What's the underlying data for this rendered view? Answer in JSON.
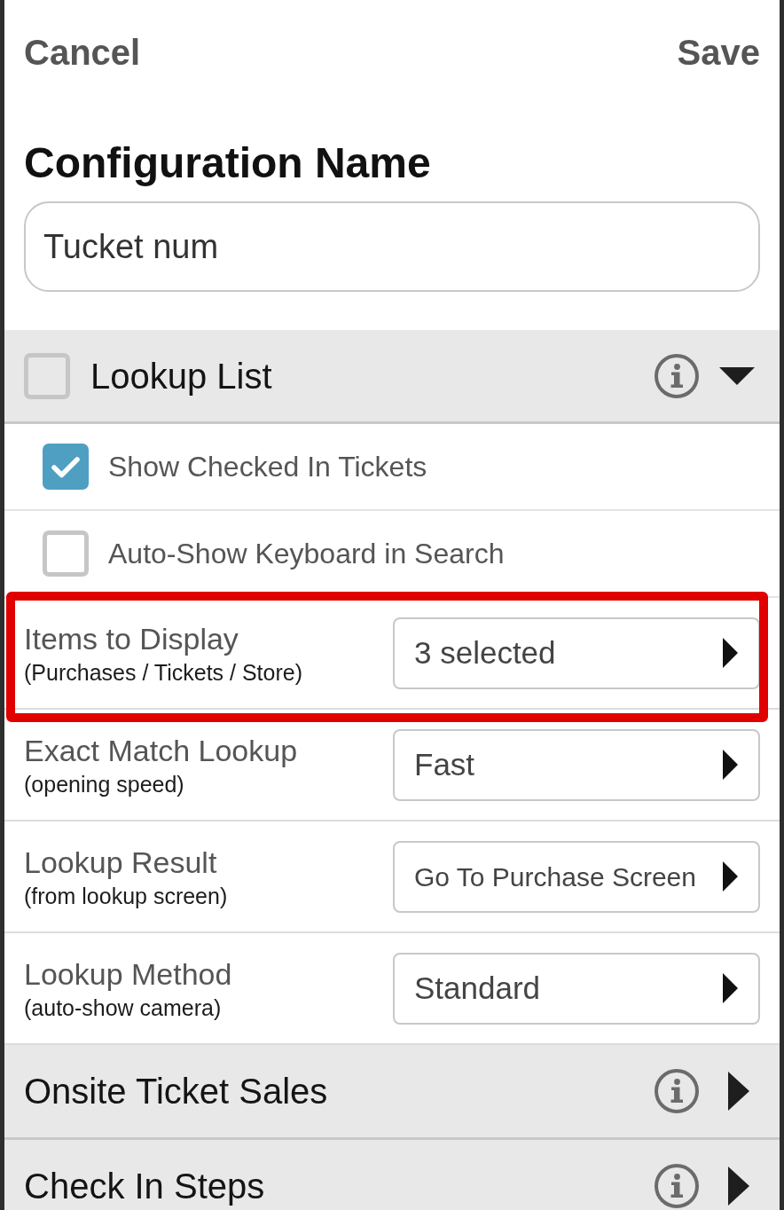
{
  "header": {
    "cancel": "Cancel",
    "save": "Save"
  },
  "configuration_name": {
    "label": "Configuration Name",
    "value": "Tucket num"
  },
  "sections": [
    {
      "title": "Lookup List",
      "kind": "checkable",
      "checked": false,
      "expanded": true,
      "options": [
        {
          "label": "Show Checked In Tickets",
          "checked": true
        },
        {
          "label": "Auto-Show Keyboard in Search",
          "checked": false
        }
      ],
      "settings": [
        {
          "label": "Items to Display",
          "hint": "(Purchases / Tickets / Store)",
          "value": "3 selected",
          "highlighted": true
        },
        {
          "label": "Exact Match Lookup",
          "hint": "(opening speed)",
          "value": "Fast",
          "highlighted": false
        },
        {
          "label": "Lookup Result",
          "hint": "(from lookup screen)",
          "value": "Go To Purchase Screen",
          "highlighted": false
        },
        {
          "label": "Lookup Method",
          "hint": "(auto-show camera)",
          "value": "Standard",
          "highlighted": false
        }
      ]
    },
    {
      "title": "Onsite Ticket Sales",
      "kind": "plain",
      "expanded": false
    },
    {
      "title": "Check In Steps",
      "kind": "plain",
      "expanded": false
    }
  ]
}
